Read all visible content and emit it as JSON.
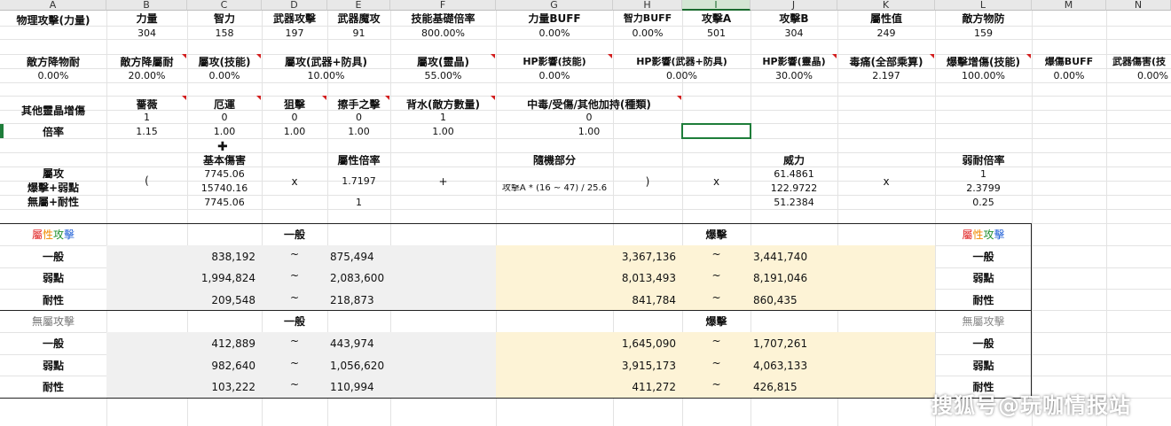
{
  "columns": [
    "A",
    "B",
    "C",
    "D",
    "E",
    "F",
    "G",
    "H",
    "I",
    "J",
    "K",
    "L",
    "M",
    "N"
  ],
  "selected_column": "I",
  "row1": {
    "labels": [
      "物理攻擊(力量)",
      "力量",
      "智力",
      "武器攻擊",
      "武器魔攻",
      "技能基礎倍率",
      "力量BUFF",
      "智力BUFF",
      "攻擊A",
      "攻擊B",
      "屬性值",
      "敵方物防"
    ]
  },
  "row2": {
    "values": [
      "304",
      "158",
      "197",
      "91",
      "800.00%",
      "0.00%",
      "0.00%",
      "501",
      "304",
      "249",
      "159"
    ]
  },
  "row3": {
    "labels": [
      "敵方降物耐",
      "敵方降屬耐",
      "屬攻(技能)",
      "屬攻(武器+防具)",
      "屬攻(靈晶)",
      "HP影響(技能)",
      "HP影響(武器+防具)",
      "HP影響(靈晶)",
      "毒痛(全部乘算)",
      "爆擊增傷(技能)",
      "爆傷BUFF",
      "武器傷害(技"
    ]
  },
  "row4": {
    "values": [
      "0.00%",
      "20.00%",
      "0.00%",
      "10.00%",
      "55.00%",
      "0.00%",
      "0.00%",
      "30.00%",
      "2.197",
      "100.00%",
      "0.00%",
      "0.00%"
    ]
  },
  "row5": {
    "label": "其他靈晶增傷",
    "items": [
      "薔薇",
      "厄運",
      "狙擊",
      "擦手之擊",
      "背水(敵方數量)",
      "中毒/受傷/其他加持(種類)"
    ],
    "values": [
      "1",
      "0",
      "0",
      "0",
      "1",
      "0"
    ]
  },
  "row6": {
    "label": "倍率",
    "values": [
      "1.15",
      "1.00",
      "1.00",
      "1.00",
      "1.00",
      "1.00"
    ]
  },
  "formula": {
    "left_labels": [
      "屬攻",
      "爆擊+弱點",
      "無屬+耐性"
    ],
    "open_paren": "(",
    "base_header": "基本傷害",
    "base_values": [
      "7745.06",
      "15740.16",
      "7745.06"
    ],
    "times": "x",
    "attr_header": "屬性倍率",
    "attr_values": [
      "1.7197",
      "1"
    ],
    "plus": "+",
    "random_header": "隨機部分",
    "random_formula": "攻擊A * (16 ~ 47) / 25.6",
    "close_paren": ")",
    "times2": "x",
    "power_header": "威力",
    "power_values": [
      "61.4861",
      "122.9722",
      "51.2384"
    ],
    "times3": "x",
    "weak_header": "弱耐倍率",
    "weak_values": [
      "1",
      "2.3799",
      "0.25"
    ]
  },
  "table1": {
    "title_chars": [
      "屬",
      "性",
      "攻",
      "擊"
    ],
    "title_colors": [
      "#e01f1f",
      "#f08a00",
      "#1f8f2e",
      "#1f5fd6"
    ],
    "normal": "一般",
    "crit": "爆擊",
    "tilde": "~",
    "rows": [
      {
        "label": "一般",
        "n_min": "838,192",
        "n_max": "875,494",
        "c_min": "3,367,136",
        "c_max": "3,441,740"
      },
      {
        "label": "弱點",
        "n_min": "1,994,824",
        "n_max": "2,083,600",
        "c_min": "8,013,493",
        "c_max": "8,191,046"
      },
      {
        "label": "耐性",
        "n_min": "209,548",
        "n_max": "218,873",
        "c_min": "841,784",
        "c_max": "860,435"
      }
    ]
  },
  "table2": {
    "title": "無屬攻擊",
    "normal": "一般",
    "crit": "爆擊",
    "tilde": "~",
    "rows": [
      {
        "label": "一般",
        "n_min": "412,889",
        "n_max": "443,974",
        "c_min": "1,645,090",
        "c_max": "1,707,261"
      },
      {
        "label": "弱點",
        "n_min": "982,640",
        "n_max": "1,056,620",
        "c_min": "3,915,173",
        "c_max": "4,063,133"
      },
      {
        "label": "耐性",
        "n_min": "103,222",
        "n_max": "110,994",
        "c_min": "411,272",
        "c_max": "426,815"
      }
    ]
  },
  "watermark": "搜狐号@玩咖情报站"
}
